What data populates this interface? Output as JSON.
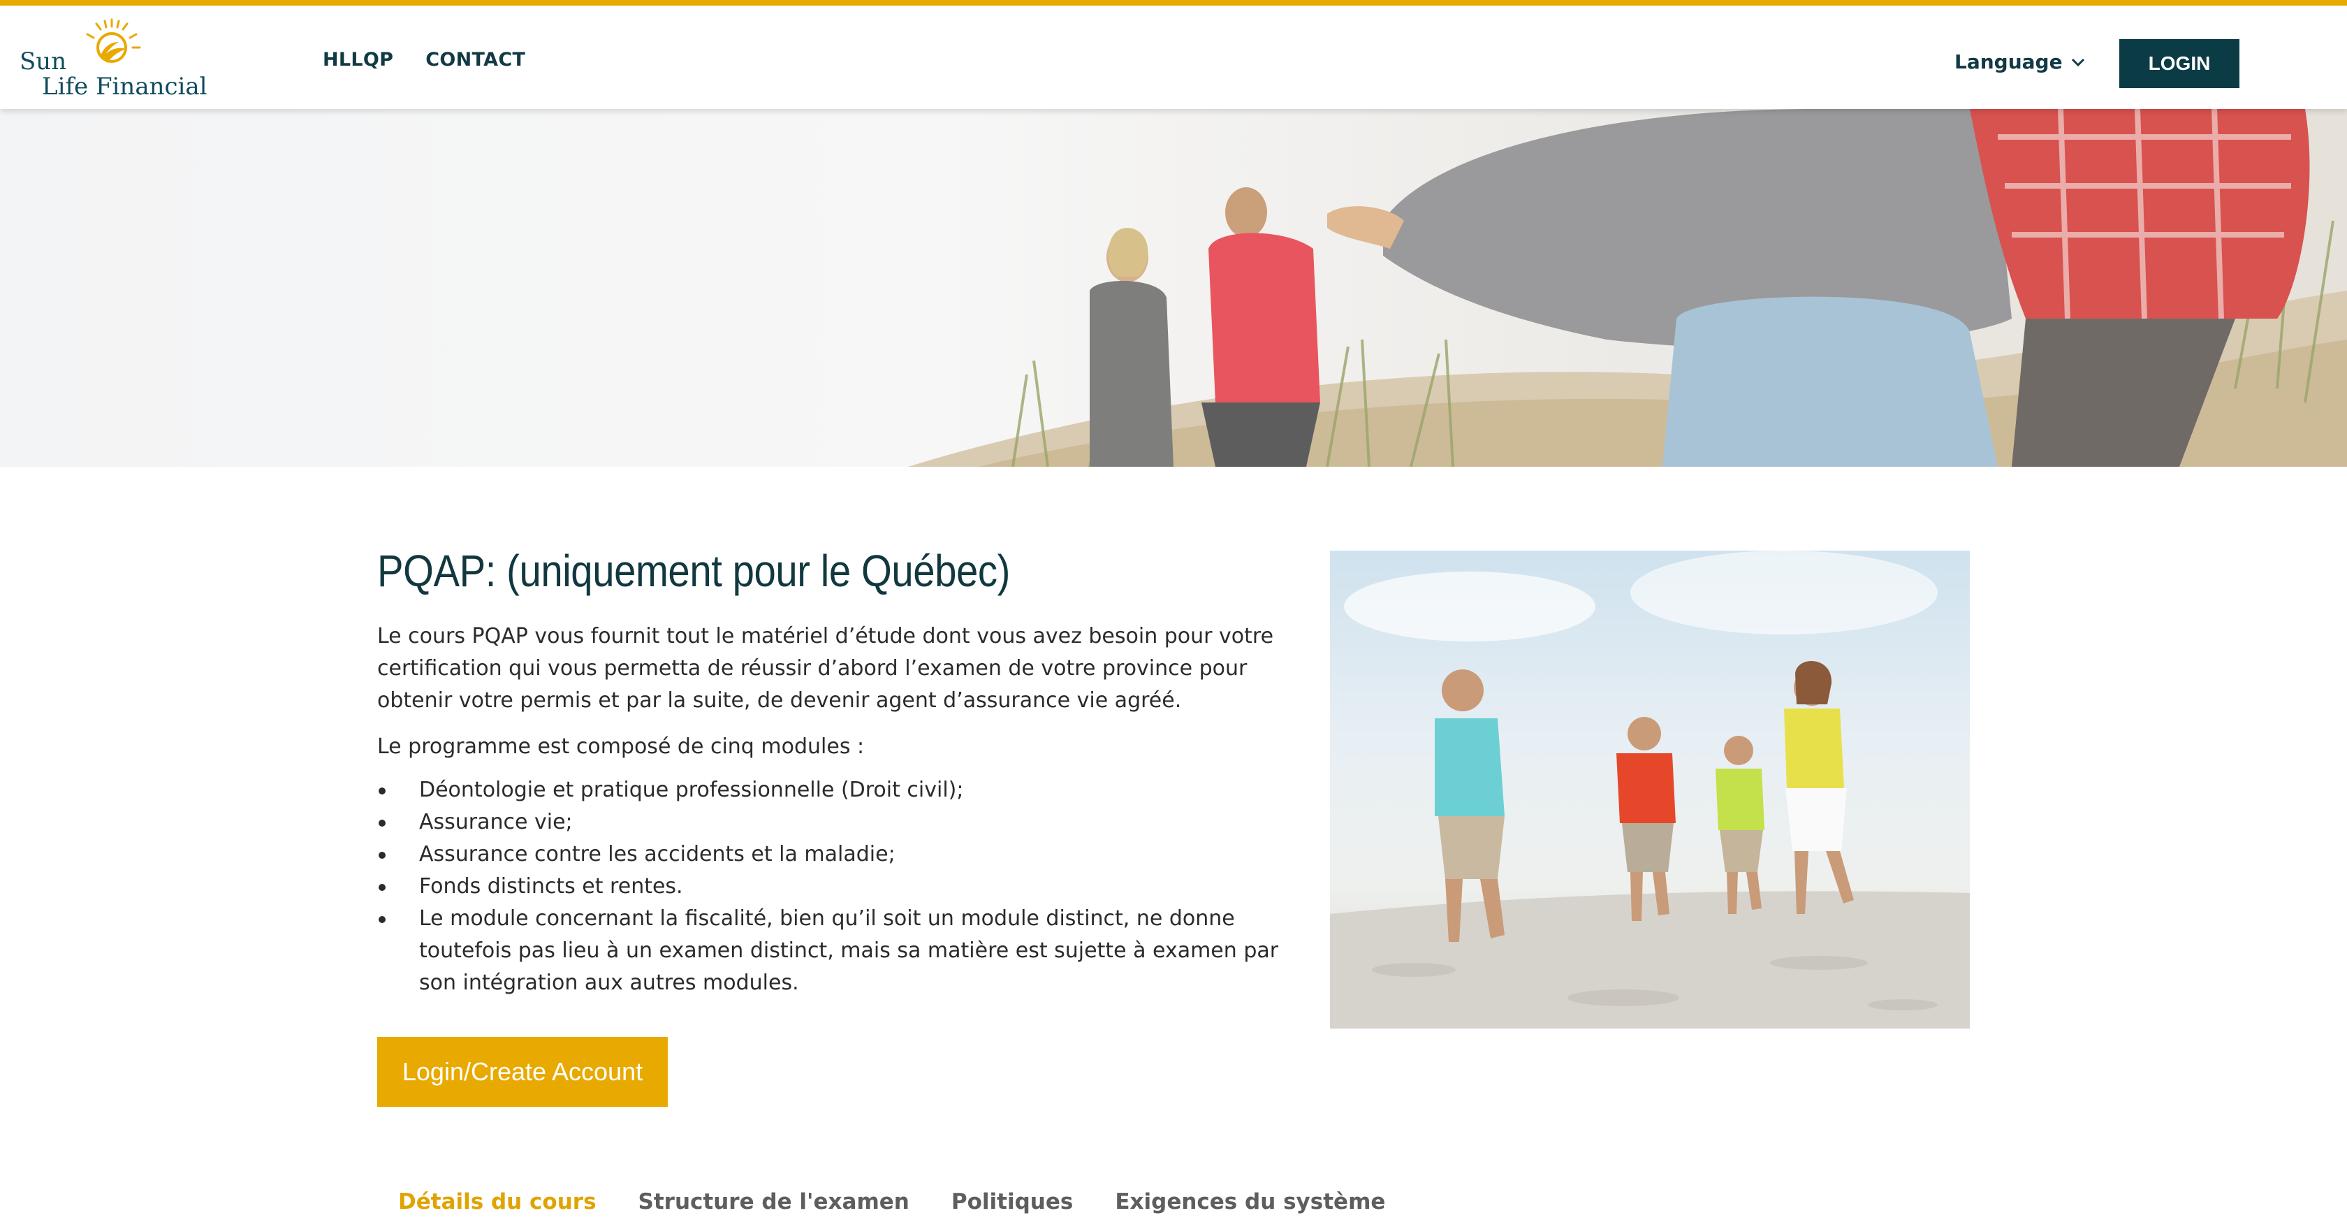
{
  "header": {
    "logo_line1": "Sun",
    "logo_line2": "Life Financial",
    "nav": [
      {
        "label": "HLLQP"
      },
      {
        "label": "CONTACT"
      }
    ],
    "language_label": "Language",
    "login_label": "LOGIN"
  },
  "main": {
    "title": "PQAP: (uniquement pour le Québec)",
    "intro": "Le cours PQAP vous fournit tout le matériel d’étude dont vous avez besoin pour votre certification qui vous permetta de réussir d’abord l’examen de votre province pour obtenir votre permis et par la suite, de devenir agent d’assurance vie agréé.",
    "modules_intro": "Le programme est composé de cinq modules :",
    "modules": [
      "Déontologie et pratique professionnelle (Droit civil);",
      "Assurance vie;",
      "Assurance contre les accidents et la maladie;",
      "Fonds distincts et rentes.",
      "Le module concernant la fiscalité, bien qu’il soit un module distinct, ne donne toutefois pas lieu à un examen distinct, mais sa matière est sujette à examen par son intégration aux autres modules."
    ],
    "cta_label": "Login/Create Account"
  },
  "tabs": [
    {
      "label": "Détails du cours",
      "active": true
    },
    {
      "label": "Structure de l'examen",
      "active": false
    },
    {
      "label": "Politiques",
      "active": false
    },
    {
      "label": "Exigences du système",
      "active": false
    }
  ],
  "colors": {
    "accent": "#e8a900",
    "dark": "#0b3b45"
  }
}
